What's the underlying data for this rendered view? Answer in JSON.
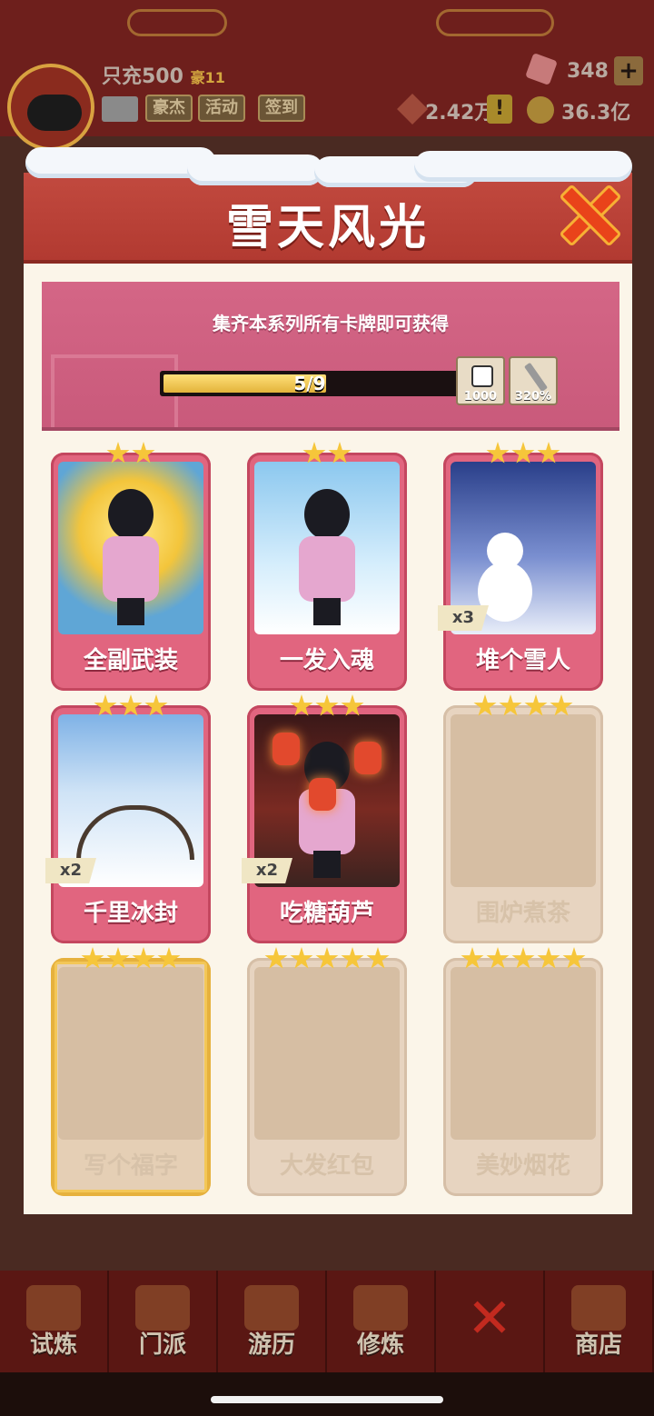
{
  "hud": {
    "vip_name": "只充500",
    "vip_level": "豪11",
    "buttons": [
      "豪杰",
      "活动",
      "签到"
    ],
    "gems": "348",
    "plus": "+",
    "power": "2.42万",
    "alert": "!",
    "gold": "36.3亿"
  },
  "modal": {
    "title": "雪天风光",
    "banner_text": "集齐本系列所有卡牌即可获得",
    "progress": {
      "current": 5,
      "total": 9,
      "label": "5/9",
      "fraction": 0.556
    },
    "rewards": [
      {
        "icon": "dice-icon",
        "value": "1000"
      },
      {
        "icon": "sword-icon",
        "value": "320%"
      }
    ],
    "cards": [
      {
        "name": "全副武装",
        "stars": 2,
        "owned": true,
        "count": "",
        "art": "art-a"
      },
      {
        "name": "一发入魂",
        "stars": 2,
        "owned": true,
        "count": "",
        "art": "art-b"
      },
      {
        "name": "堆个雪人",
        "stars": 3,
        "owned": true,
        "count": "x3",
        "art": "art-c"
      },
      {
        "name": "千里冰封",
        "stars": 3,
        "owned": true,
        "count": "x2",
        "art": "art-d"
      },
      {
        "name": "吃糖葫芦",
        "stars": 3,
        "owned": true,
        "count": "x2",
        "art": "art-e"
      },
      {
        "name": "围炉煮茶",
        "stars": 4,
        "owned": false,
        "count": "",
        "art": ""
      },
      {
        "name": "写个福字",
        "stars": 4,
        "owned": false,
        "count": "",
        "art": "",
        "gold": true
      },
      {
        "name": "大发红包",
        "stars": 5,
        "owned": false,
        "count": "",
        "art": ""
      },
      {
        "name": "美妙烟花",
        "stars": 5,
        "owned": false,
        "count": "",
        "art": ""
      }
    ]
  },
  "bottom_nav": {
    "tabs": [
      "试炼",
      "门派",
      "游历",
      "修炼",
      "",
      "商店"
    ],
    "close_icon": "close-icon"
  },
  "colors": {
    "header_red": "#b23a31",
    "banner_pink": "#d46686",
    "card_pink": "#e1657f",
    "star_gold": "#f6c63a"
  }
}
